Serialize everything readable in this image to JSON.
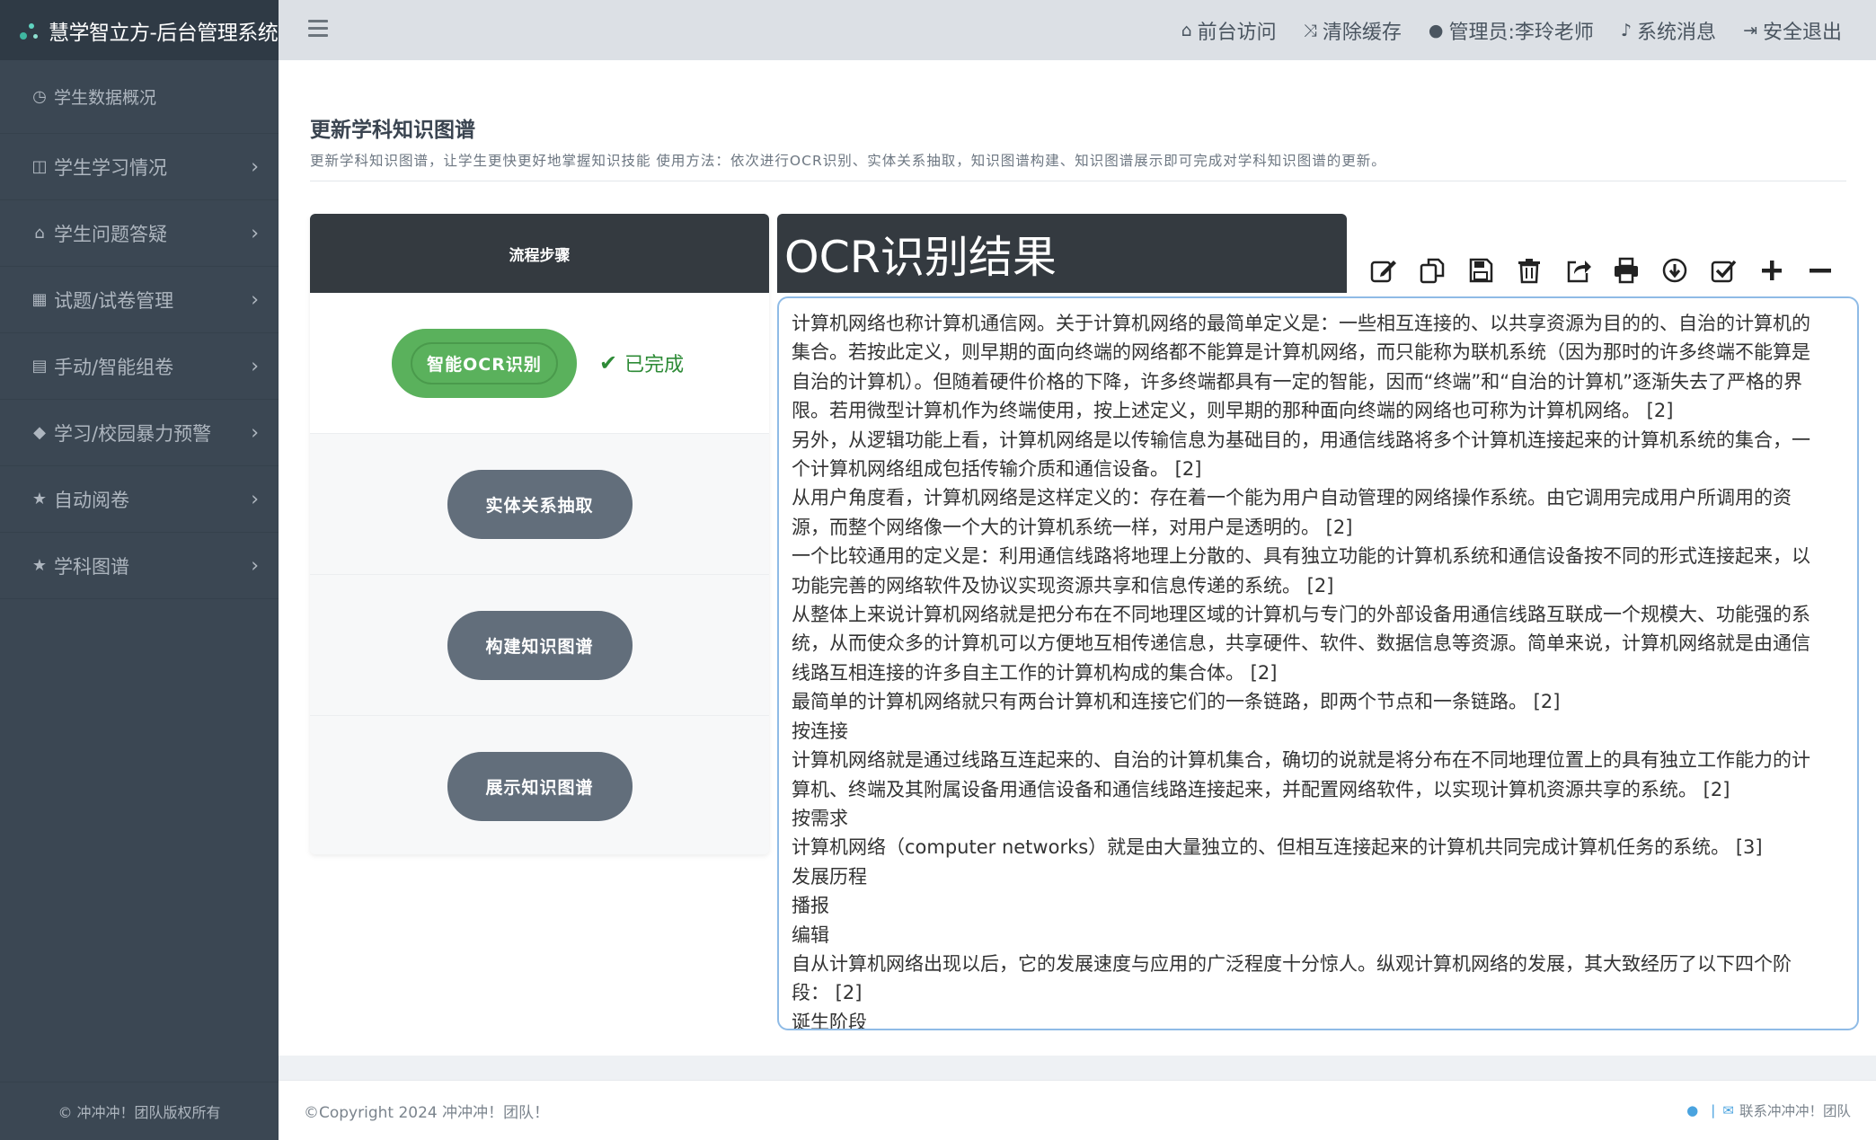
{
  "brand": {
    "title": "慧学智立方-后台管理系统"
  },
  "sidebar": {
    "items": [
      {
        "label": "学生数据概况",
        "icon": "dashboard-icon",
        "glyph": "◷"
      },
      {
        "label": "学生学习情况",
        "icon": "columns-icon",
        "glyph": "◫"
      },
      {
        "label": "学生问题答疑",
        "icon": "inbox-icon",
        "glyph": "⌂"
      },
      {
        "label": "试题/试卷管理",
        "icon": "table-icon",
        "glyph": "▦"
      },
      {
        "label": "手动/智能组卷",
        "icon": "list-alt-icon",
        "glyph": "▤"
      },
      {
        "label": "学习/校园暴力预警",
        "icon": "tags-icon",
        "glyph": "◆"
      },
      {
        "label": "自动阅卷",
        "icon": "star-icon",
        "glyph": "★"
      },
      {
        "label": "学科图谱",
        "icon": "star-icon",
        "glyph": "★"
      }
    ],
    "footer": "© 冲冲冲！团队版权所有"
  },
  "topnav": {
    "front": "前台访问",
    "clear_cache": "清除缓存",
    "admin": "管理员:李玲老师",
    "messages": "系统消息",
    "logout": "安全退出"
  },
  "page": {
    "title": "更新学科知识图谱",
    "desc": "更新学科知识图谱，让学生更快更好地掌握知识技能 使用方法：依次进行OCR识别、实体关系抽取，知识图谱构建、知识图谱展示即可完成对学科知识图谱的更新。"
  },
  "steps": {
    "header": "流程步骤",
    "items": [
      {
        "label": "智能OCR识别"
      },
      {
        "label": "实体关系抽取"
      },
      {
        "label": "构建知识图谱"
      },
      {
        "label": "展示知识图谱"
      }
    ],
    "done_label": "已完成"
  },
  "ocr": {
    "title": "OCR识别结果",
    "toolbar": [
      "edit-icon",
      "copy-icon",
      "save-icon",
      "delete-icon",
      "share-icon",
      "print-icon",
      "download-icon",
      "check-icon",
      "plus-icon",
      "minus-icon"
    ],
    "lines": [
      "计算机网络也称计算机通信网。关于计算机网络的最简单定义是：一些相互连接的、以共享资源为目的的、自治的计算机的",
      "集合。若按此定义，则早期的面向终端的网络都不能算是计算机网络，而只能称为联机系统（因为那时的许多终端不能算是",
      "自治的计算机）。但随着硬件价格的下降，许多终端都具有一定的智能，因而“终端”和“自治的计算机”逐渐失去了严格的界",
      "限。若用微型计算机作为终端使用，按上述定义，则早期的那种面向终端的网络也可称为计算机网络。 [2]",
      "另外，从逻辑功能上看，计算机网络是以传输信息为基础目的，用通信线路将多个计算机连接起来的计算机系统的集合，一",
      "个计算机网络组成包括传输介质和通信设备。 [2]",
      "从用户角度看，计算机网络是这样定义的：存在着一个能为用户自动管理的网络操作系统。由它调用完成用户所调用的资",
      "源，而整个网络像一个大的计算机系统一样，对用户是透明的。 [2]",
      "一个比较通用的定义是：利用通信线路将地理上分散的、具有独立功能的计算机系统和通信设备按不同的形式连接起来，以",
      "功能完善的网络软件及协议实现资源共享和信息传递的系统。 [2]",
      "从整体上来说计算机网络就是把分布在不同地理区域的计算机与专门的外部设备用通信线路互联成一个规模大、功能强的系",
      "统，从而使众多的计算机可以方便地互相传递信息，共享硬件、软件、数据信息等资源。简单来说，计算机网络就是由通信",
      "线路互相连接的许多自主工作的计算机构成的集合体。 [2]",
      "最简单的计算机网络就只有两台计算机和连接它们的一条链路，即两个节点和一条链路。 [2]",
      "按连接",
      "计算机网络就是通过线路互连起来的、自治的计算机集合，确切的说就是将分布在不同地理位置上的具有独立工作能力的计",
      "算机、终端及其附属设备用通信设备和通信线路连接起来，并配置网络软件，以实现计算机资源共享的系统。 [2]",
      "按需求",
      "计算机网络（computer networks）就是由大量独立的、但相互连接起来的计算机共同完成计算机任务的系统。 [3]",
      "发展历程",
      "播报",
      "编辑",
      "自从计算机网络出现以后，它的发展速度与应用的广泛程度十分惊人。纵观计算机网络的发展，其大致经历了以下四个阶",
      "段： [2]",
      "诞生阶段"
    ]
  },
  "footer": {
    "copyright": "©Copyright 2024 冲冲冲！团队！",
    "contact": "联系冲冲冲！团队"
  }
}
